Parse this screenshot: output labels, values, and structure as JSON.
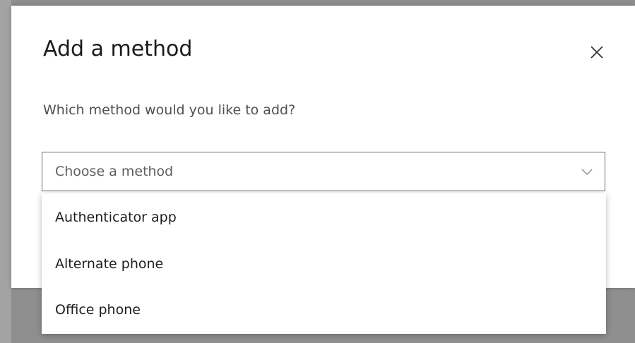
{
  "dialog": {
    "title": "Add a method",
    "question": "Which method would you like to add?",
    "close_icon": "close-icon"
  },
  "method_select": {
    "placeholder": "Choose a method",
    "chevron_icon": "chevron-down-icon",
    "options": [
      {
        "label": "Authenticator app"
      },
      {
        "label": "Alternate phone"
      },
      {
        "label": "Office phone"
      }
    ]
  }
}
